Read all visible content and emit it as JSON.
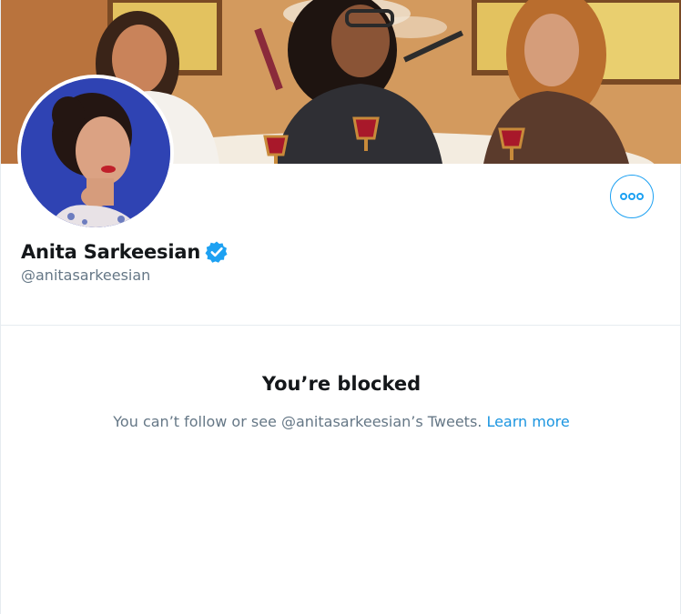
{
  "profile": {
    "display_name": "Anita Sarkeesian",
    "handle": "@anitasarkeesian",
    "verified": true
  },
  "icons": {
    "verified": "verified-badge-icon",
    "more": "more-options-icon"
  },
  "blocked": {
    "title": "You’re blocked",
    "message": "You can’t follow or see @anitasarkeesian’s Tweets.",
    "learn_more": "Learn more"
  },
  "colors": {
    "accent": "#1da1f2",
    "link": "#1b95e0",
    "text_primary": "#14171a",
    "text_secondary": "#657786",
    "divider": "#e6ecf0"
  }
}
